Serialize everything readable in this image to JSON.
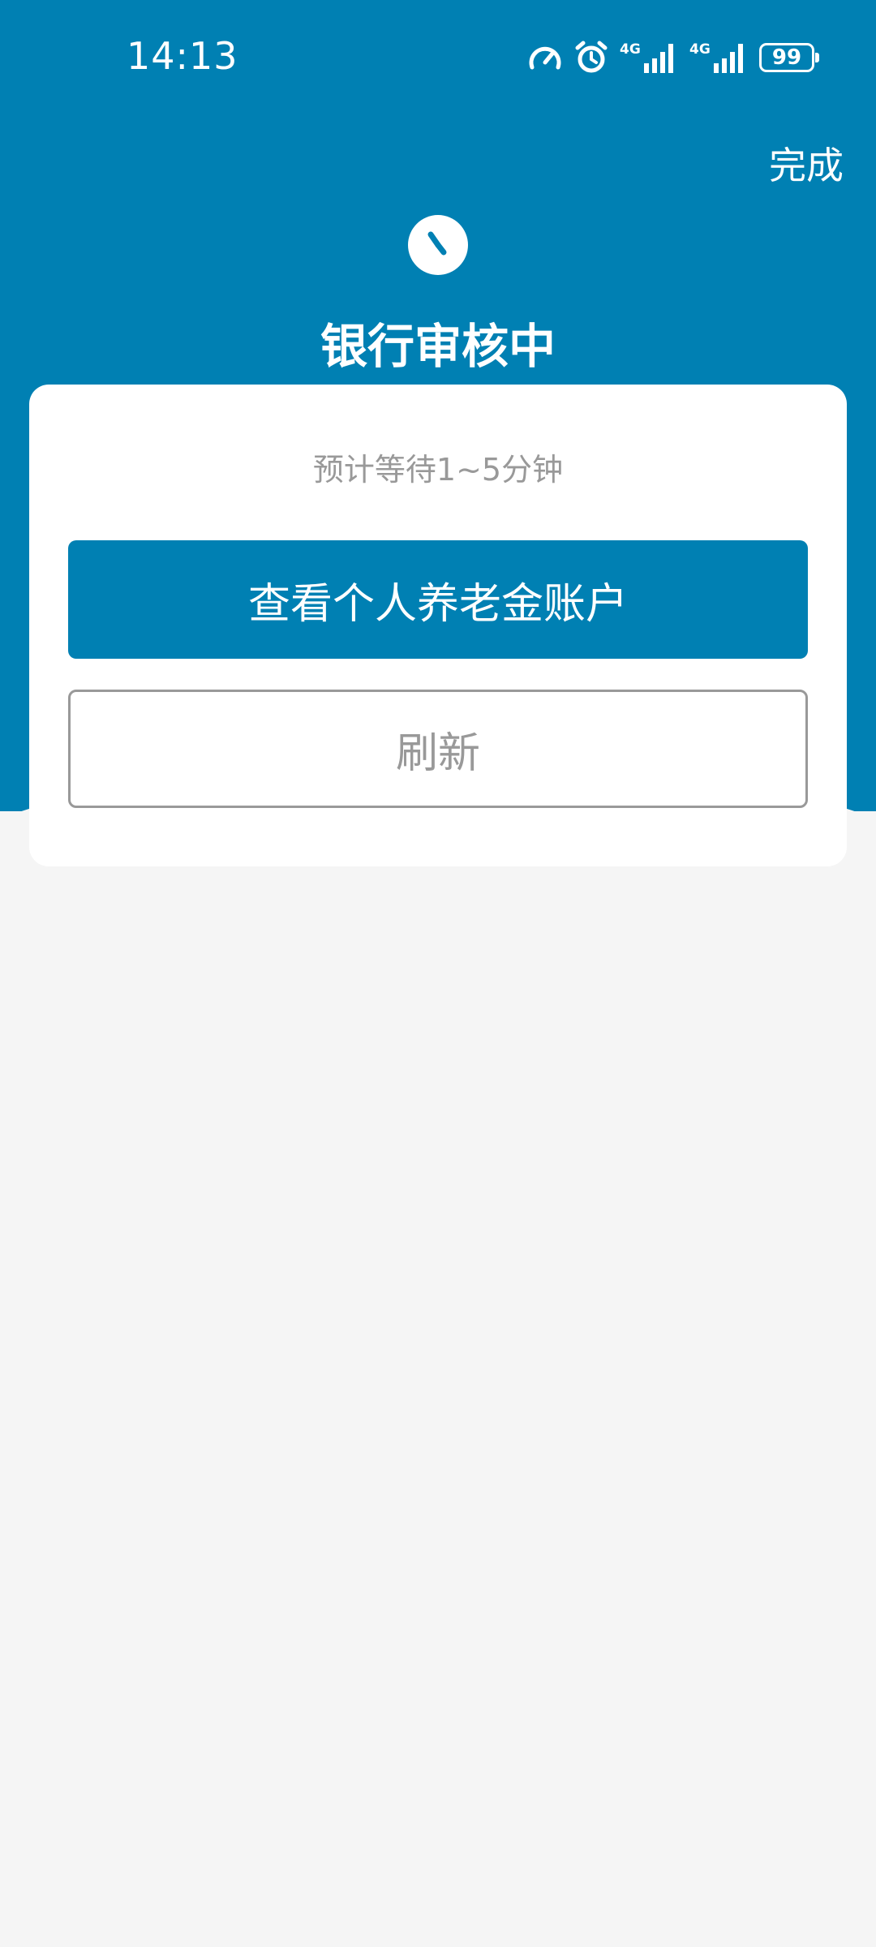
{
  "status_bar": {
    "time": "14:13",
    "battery": "99",
    "network_labels": [
      "4G",
      "4G"
    ]
  },
  "header": {
    "done_label": "完成",
    "title": "银行审核中"
  },
  "card": {
    "wait_text": "预计等待1~5分钟",
    "primary_button_label": "查看个人养老金账户",
    "refresh_button_label": "刷新"
  },
  "icons": {
    "clock": "clock-icon",
    "speedometer": "speedometer-icon",
    "alarm": "alarm-icon",
    "signal": "signal-icon",
    "battery": "battery-icon"
  },
  "colors": {
    "brand": "#0080b3",
    "background": "#f5f5f5",
    "muted_text": "#999999"
  }
}
